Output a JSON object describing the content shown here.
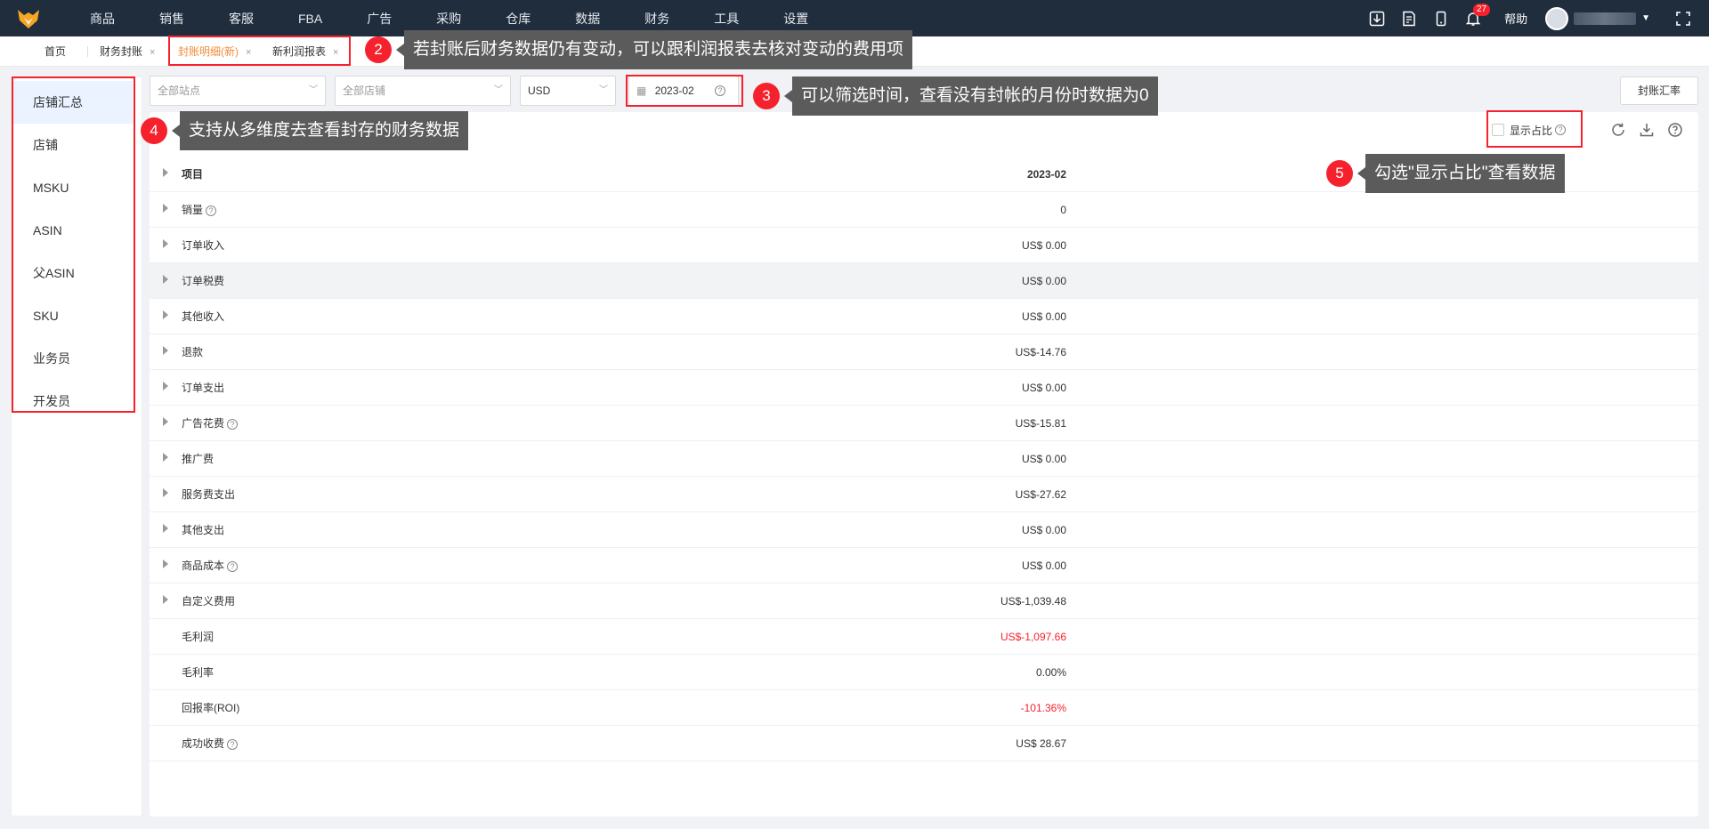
{
  "nav": {
    "items": [
      "商品",
      "销售",
      "客服",
      "FBA",
      "广告",
      "采购",
      "仓库",
      "数据",
      "财务",
      "工具",
      "设置"
    ],
    "notification_count": "27",
    "help": "帮助"
  },
  "tabs": {
    "home": "首页",
    "items": [
      {
        "label": "财务封账"
      },
      {
        "label": "封账明细(新)"
      },
      {
        "label": "新利润报表"
      }
    ]
  },
  "callouts": [
    {
      "num": "2",
      "text": "若封账后财务数据仍有变动，可以跟利润报表去核对变动的费用项"
    },
    {
      "num": "3",
      "text": "可以筛选时间，查看没有封帐的月份时数据为0"
    },
    {
      "num": "4",
      "text": "支持从多维度去查看封存的财务数据"
    },
    {
      "num": "5",
      "text": "勾选\"显示占比\"查看数据"
    }
  ],
  "sidebar": {
    "items": [
      "店铺汇总",
      "店铺",
      "MSKU",
      "ASIN",
      "父ASIN",
      "SKU",
      "业务员",
      "开发员"
    ]
  },
  "filters": {
    "site_placeholder": "全部站点",
    "shop_placeholder": "全部店铺",
    "currency": "USD",
    "month": "2023-02",
    "summary_button": "封账汇率"
  },
  "toolbar": {
    "show_ratio": "显示占比"
  },
  "table": {
    "header": {
      "label": "项目",
      "value": "2023-02"
    },
    "rows": [
      {
        "label": "销量",
        "value": "0"
      },
      {
        "label": "订单收入",
        "value": "US$ 0.00"
      },
      {
        "label": "订单税费",
        "value": "US$ 0.00"
      },
      {
        "label": "其他收入",
        "value": "US$ 0.00"
      },
      {
        "label": "退款",
        "value": "US$-14.76"
      },
      {
        "label": "订单支出",
        "value": "US$ 0.00"
      },
      {
        "label": "广告花费",
        "value": "US$-15.81"
      },
      {
        "label": "推广费",
        "value": "US$ 0.00"
      },
      {
        "label": "服务费支出",
        "value": "US$-27.62"
      },
      {
        "label": "其他支出",
        "value": "US$ 0.00"
      },
      {
        "label": "商品成本",
        "value": "US$ 0.00"
      },
      {
        "label": "自定义费用",
        "value": "US$-1,039.48"
      },
      {
        "label": "毛利润",
        "value": "US$-1,097.66"
      },
      {
        "label": "毛利率",
        "value": "0.00%"
      },
      {
        "label": "回报率(ROI)",
        "value": "-101.36%"
      },
      {
        "label": "成功收费",
        "value": "US$ 28.67"
      }
    ]
  },
  "colors": {
    "accent": "#f08c3a",
    "alert": "#f5222d",
    "nav_bg": "#1f2d3d"
  }
}
